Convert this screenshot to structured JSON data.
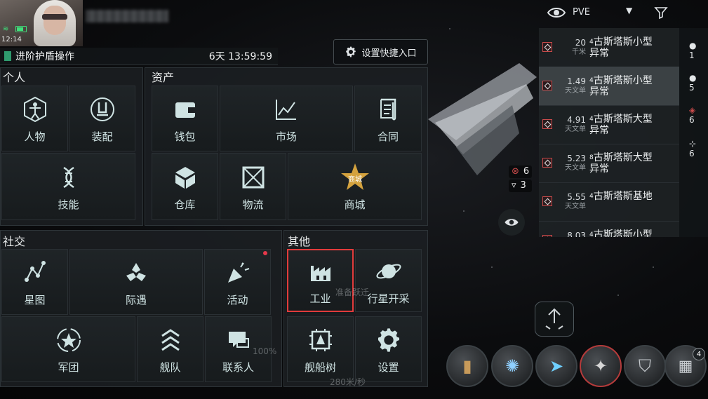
{
  "status_bar": {
    "time": "12:14"
  },
  "mission": {
    "title": "进阶护盾操作",
    "timer": "6天 13:59:59"
  },
  "shortcut_button": {
    "label": "设置快捷入口",
    "icon": "gear-icon"
  },
  "sections": {
    "personal": {
      "title": "个人",
      "items": [
        {
          "label": "人物",
          "icon": "vitruvian-icon"
        },
        {
          "label": "装配",
          "icon": "fitting-icon"
        },
        {
          "label": "技能",
          "icon": "dna-icon"
        }
      ]
    },
    "assets": {
      "title": "资产",
      "items": [
        {
          "label": "钱包",
          "icon": "wallet-icon"
        },
        {
          "label": "市场",
          "icon": "chart-icon"
        },
        {
          "label": "合同",
          "icon": "scroll-icon"
        },
        {
          "label": "仓库",
          "icon": "cube-icon"
        },
        {
          "label": "物流",
          "icon": "crate-icon"
        },
        {
          "label": "商城",
          "icon": "store-star-icon",
          "badge": "商城"
        }
      ]
    },
    "social": {
      "title": "社交",
      "items": [
        {
          "label": "星图",
          "icon": "constellation-icon"
        },
        {
          "label": "际遇",
          "icon": "encounter-icon"
        },
        {
          "label": "活动",
          "icon": "party-icon"
        },
        {
          "label": "军团",
          "icon": "corp-star-icon"
        },
        {
          "label": "舰队",
          "icon": "chevrons-icon"
        },
        {
          "label": "联系人",
          "icon": "chat-icon"
        }
      ]
    },
    "other": {
      "title": "其他",
      "items": [
        {
          "label": "工业",
          "icon": "factory-icon"
        },
        {
          "label": "行星开采",
          "icon": "planet-icon"
        },
        {
          "label": "舰船树",
          "icon": "ship-tree-icon"
        },
        {
          "label": "设置",
          "icon": "gear-icon"
        }
      ]
    }
  },
  "filter": {
    "mode": "PVE"
  },
  "overview": [
    {
      "distance": "20",
      "unit": "千米",
      "prefix": "4",
      "name": "古斯塔斯小型",
      "name2": "异常",
      "selected": false
    },
    {
      "distance": "1.49",
      "unit": "天文单",
      "prefix": "4",
      "name": "古斯塔斯小型",
      "name2": "异常",
      "selected": true
    },
    {
      "distance": "4.91",
      "unit": "天文单",
      "prefix": "4",
      "name": "古斯塔斯大型",
      "name2": "异常",
      "selected": false
    },
    {
      "distance": "5.23",
      "unit": "天文单",
      "prefix": "8",
      "name": "古斯塔斯大型",
      "name2": "异常",
      "selected": false
    },
    {
      "distance": "5.55",
      "unit": "天文单",
      "prefix": "4",
      "name": "古斯塔斯基地",
      "name2": "",
      "selected": false
    },
    {
      "distance": "8.03",
      "unit": "",
      "prefix": "4",
      "name": "古斯塔斯小型",
      "name2": "",
      "selected": false
    }
  ],
  "side_counts": [
    "1",
    "5",
    "6",
    "6"
  ],
  "target_counts": [
    {
      "icon": "hostile-icon",
      "value": "6"
    },
    {
      "icon": "drone-icon",
      "value": "3"
    }
  ],
  "ghost_text": {
    "warp": "准备跃迁",
    "speed": "280米/秒",
    "percent": "100%"
  },
  "module_badge": "4",
  "colors": {
    "highlight": "#e23b3b",
    "accent": "#2f9a6e",
    "hostile": "#c94b4b"
  }
}
